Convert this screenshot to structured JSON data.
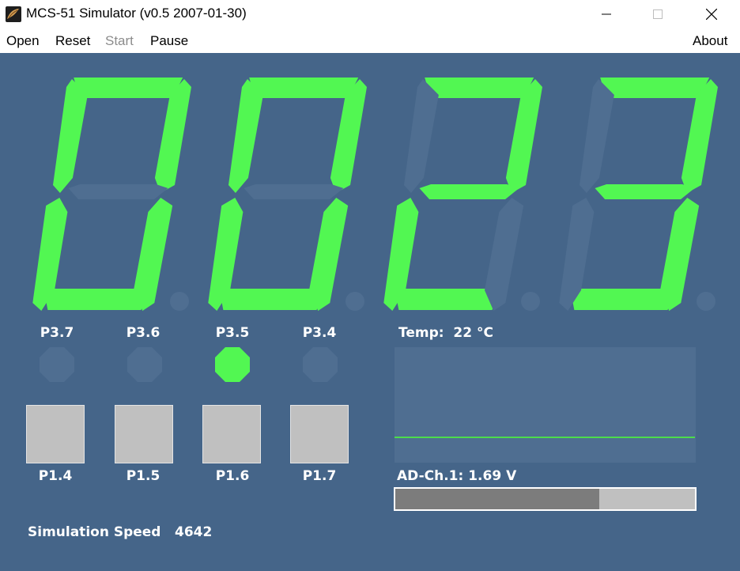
{
  "window": {
    "title": "MCS-51 Simulator (v0.5 2007-01-30)"
  },
  "menu": {
    "open": "Open",
    "reset": "Reset",
    "start": "Start",
    "pause": "Pause",
    "about": "About"
  },
  "display": {
    "digits": [
      "0",
      "0",
      "2",
      "3"
    ],
    "decimal_points_lit": [
      false,
      false,
      false,
      false
    ],
    "on_color": "#52f752",
    "off_color": "#4f6e91"
  },
  "leds": [
    {
      "label": "P3.7",
      "on": false
    },
    {
      "label": "P3.6",
      "on": false
    },
    {
      "label": "P3.5",
      "on": true
    },
    {
      "label": "P3.4",
      "on": false
    }
  ],
  "buttons": [
    {
      "label": "P1.4"
    },
    {
      "label": "P1.5"
    },
    {
      "label": "P1.6"
    },
    {
      "label": "P1.7"
    }
  ],
  "temperature": {
    "label": "Temp:  22 °C",
    "trace_color": "#4cdc4c"
  },
  "adc": {
    "label": "AD-Ch.1: 1.69 V",
    "level_fraction": 0.68
  },
  "speed": {
    "label": "Simulation Speed",
    "value": "4642"
  },
  "colors": {
    "background": "#456589",
    "panel": "#4f6e91",
    "button_face": "#c0c0c0",
    "bar_fill": "#7c7c7c"
  }
}
